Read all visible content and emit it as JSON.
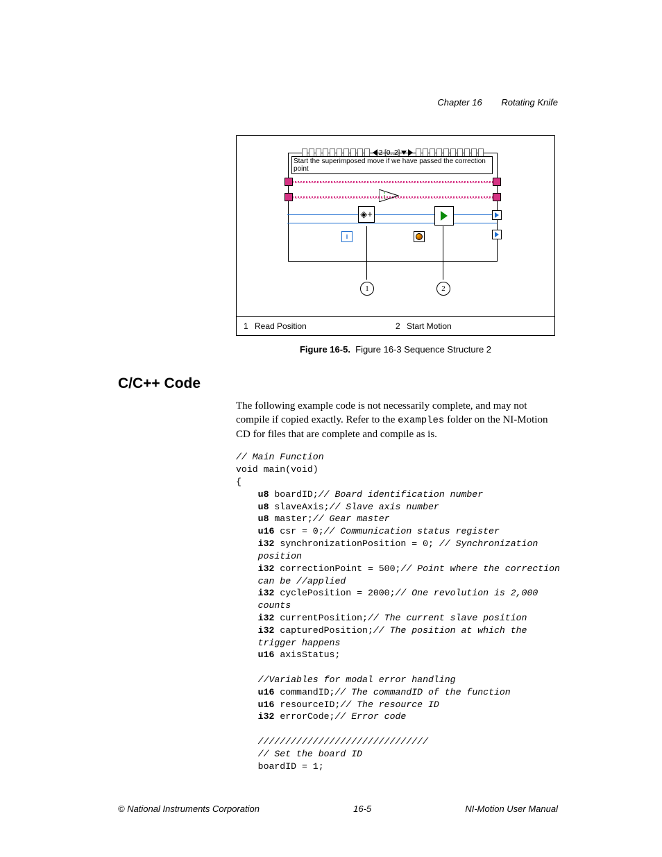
{
  "header": {
    "chapter": "Chapter 16",
    "title": "Rotating Knife"
  },
  "figure": {
    "seq_label": "2 [0..2]",
    "comment_box": "Start the superimposed move if we have passed the correction point",
    "callouts": {
      "c1": "1",
      "c2": "2"
    },
    "legend": {
      "n1": "1",
      "l1": "Read Position",
      "n2": "2",
      "l2": "Start Motion"
    },
    "caption_bold": "Figure 16-5.",
    "caption_text": "Figure 16-3 Sequence Structure 2"
  },
  "section_heading": "C/C++ Code",
  "paragraph_before": "The following example code is not necessarily complete, and may not compile if copied exactly. Refer to the ",
  "paragraph_code": "examples",
  "paragraph_after": " folder on the NI-Motion CD for files that are complete and compile as is.",
  "code_lines": [
    {
      "pre": "",
      "bold": "",
      "ital": "// Main Function"
    },
    {
      "pre": "void main(void)"
    },
    {
      "pre": "{"
    },
    {
      "indent": 1,
      "bold": "u8",
      "rest": " boardID;",
      "ital": "// Board identification number"
    },
    {
      "indent": 1,
      "bold": "u8",
      "rest": " slaveAxis;",
      "ital": "// Slave axis number"
    },
    {
      "indent": 1,
      "bold": "u8",
      "rest": " master;",
      "ital": "// Gear master"
    },
    {
      "indent": 1,
      "bold": "u16",
      "rest": " csr = 0;",
      "ital": "// Communication status register"
    },
    {
      "indent": 1,
      "bold": "i32",
      "rest": " synchronizationPosition = 0; ",
      "ital": "// Synchronization"
    },
    {
      "indent": 1,
      "ital": "position"
    },
    {
      "indent": 1,
      "bold": "i32",
      "rest": " correctionPoint = 500;",
      "ital": "// Point where the correction"
    },
    {
      "indent": 1,
      "ital": "can be //applied"
    },
    {
      "indent": 1,
      "bold": "i32",
      "rest": " cyclePosition = 2000;",
      "ital": "// One revolution is 2,000"
    },
    {
      "indent": 1,
      "ital": "counts"
    },
    {
      "indent": 1,
      "bold": "i32",
      "rest": " currentPosition;",
      "ital": "// The current slave position"
    },
    {
      "indent": 1,
      "bold": "i32",
      "rest": " capturedPosition;",
      "ital": "// The position at which the"
    },
    {
      "indent": 1,
      "ital": "trigger happens"
    },
    {
      "indent": 1,
      "bold": "u16",
      "rest": " axisStatus;"
    },
    {
      "blank": true
    },
    {
      "indent": 1,
      "ital": "//Variables for modal error handling"
    },
    {
      "indent": 1,
      "bold": "u16",
      "rest": " commandID;",
      "ital": "// The commandID of the function"
    },
    {
      "indent": 1,
      "bold": "u16",
      "rest": " resourceID;",
      "ital": "// The resource ID"
    },
    {
      "indent": 1,
      "bold": "i32",
      "rest": " errorCode;",
      "ital": "// Error code"
    },
    {
      "blank": true
    },
    {
      "indent": 1,
      "ital": "///////////////////////////////"
    },
    {
      "indent": 1,
      "ital": "// Set the board ID"
    },
    {
      "indent": 1,
      "rest": "boardID = 1;"
    }
  ],
  "footer": {
    "left": "© National Instruments Corporation",
    "center": "16-5",
    "right": "NI-Motion User Manual"
  }
}
